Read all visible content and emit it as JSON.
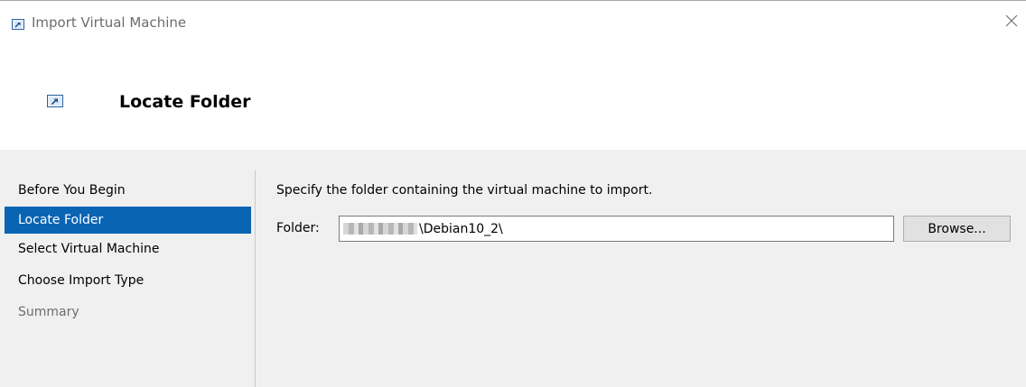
{
  "window": {
    "title": "Import Virtual Machine",
    "close_icon": "close-icon"
  },
  "header": {
    "icon": "import-vm-icon",
    "title": "Locate Folder"
  },
  "steps": [
    {
      "label": "Before You Begin",
      "state": "enabled"
    },
    {
      "label": "Locate Folder",
      "state": "active"
    },
    {
      "label": "Select Virtual Machine",
      "state": "enabled"
    },
    {
      "label": "Choose Import Type",
      "state": "enabled"
    },
    {
      "label": "Summary",
      "state": "disabled"
    }
  ],
  "main": {
    "instruction": "Specify the folder containing the virtual machine to import.",
    "folder_label": "Folder:",
    "folder_value_suffix": "\\Debian10_2\\",
    "folder_value_redacted": true,
    "browse_label": "Browse..."
  },
  "colors": {
    "selection": "#0a64b4",
    "panel_bg": "#f0f0f0",
    "disabled_text": "#6d6d6d"
  }
}
